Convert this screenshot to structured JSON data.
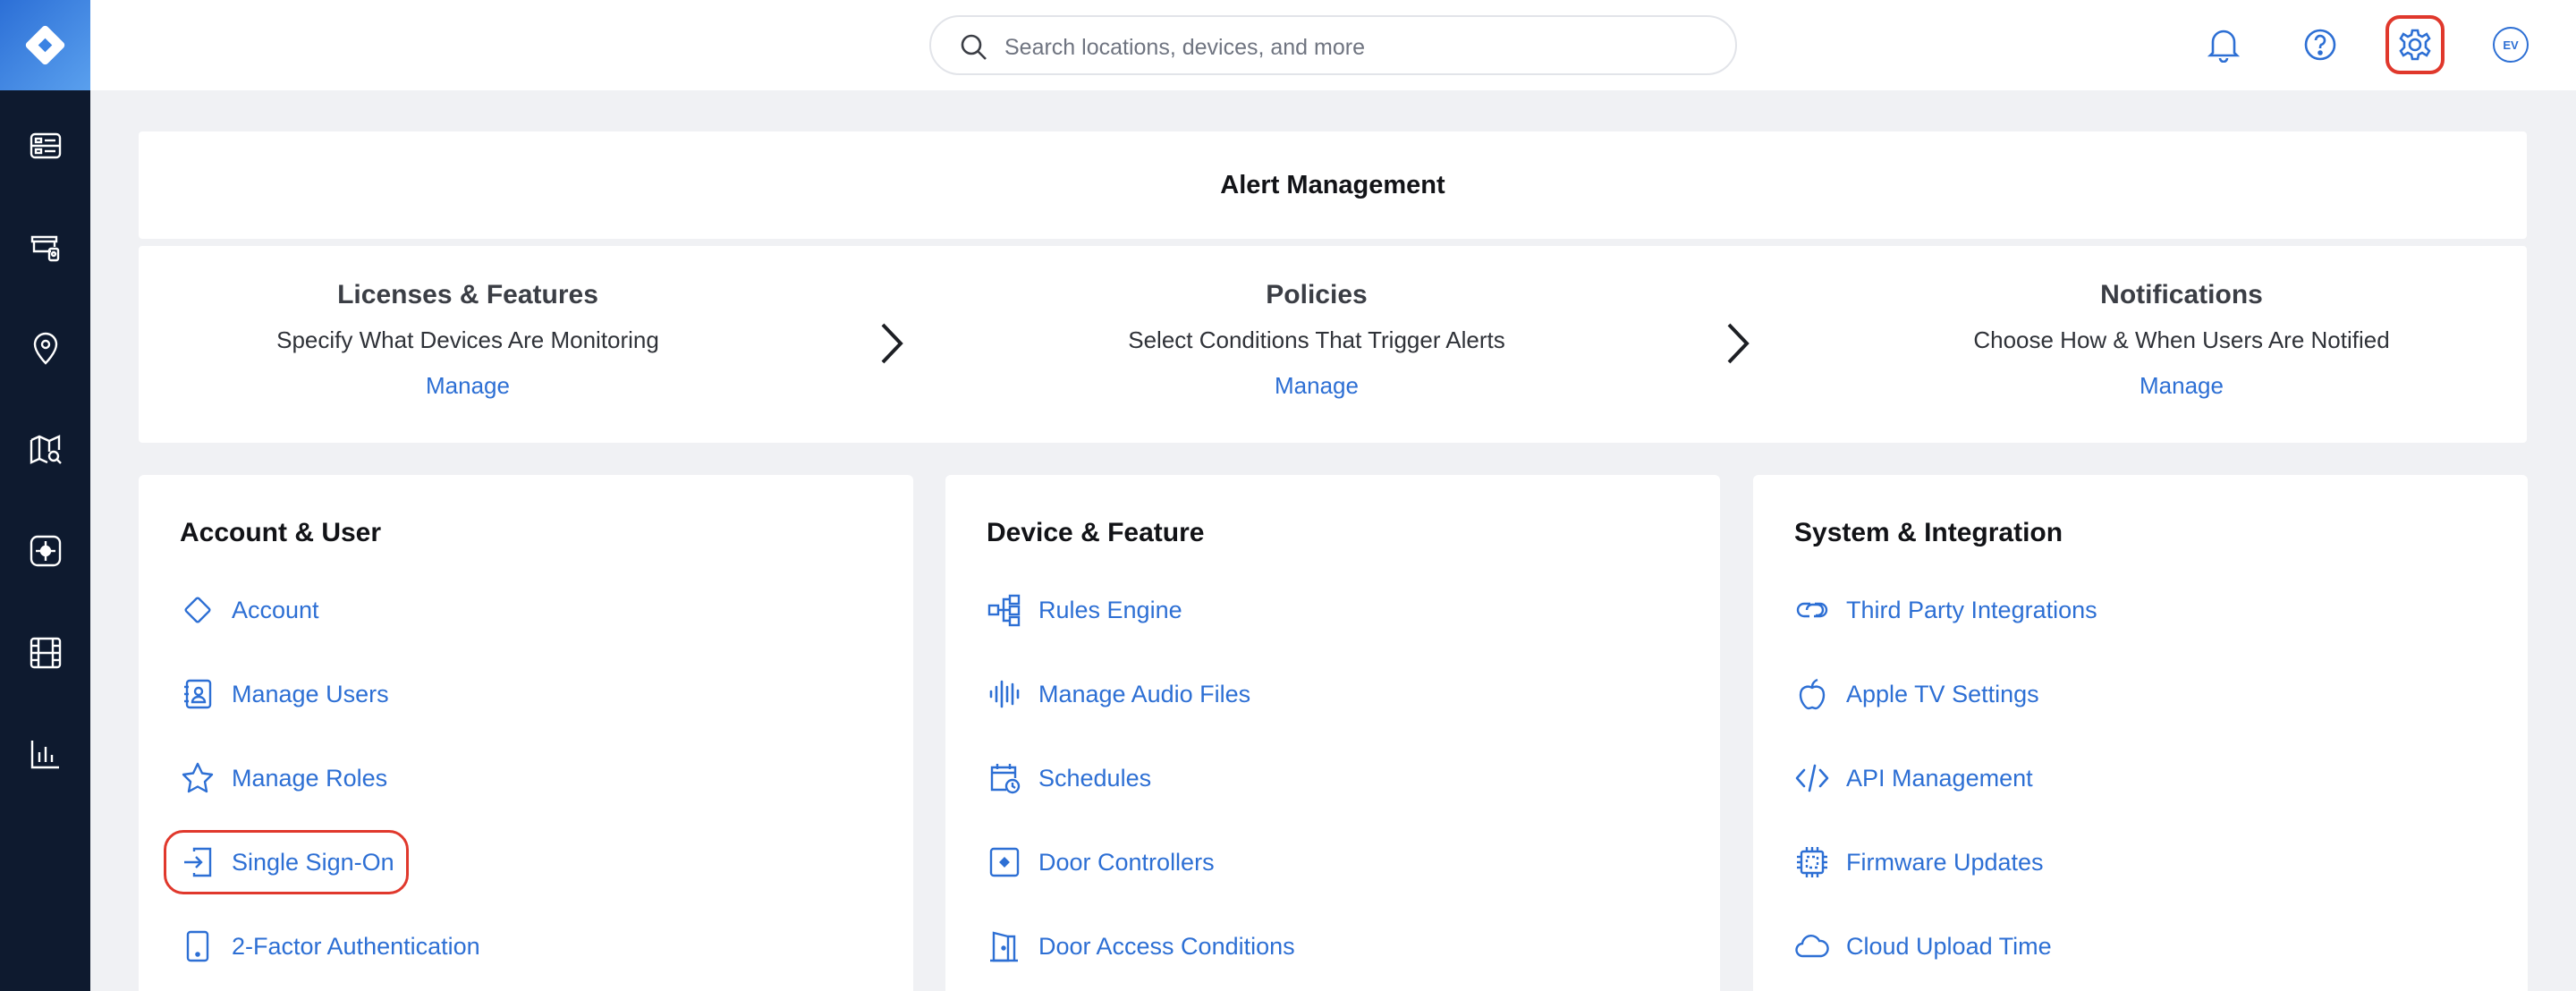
{
  "sidebar": {
    "logo": "brand-diamond-logo",
    "items": [
      {
        "icon": "dashboard-icon"
      },
      {
        "icon": "camera-devices-icon"
      },
      {
        "icon": "location-pin-icon"
      },
      {
        "icon": "map-search-icon"
      },
      {
        "icon": "access-control-icon"
      },
      {
        "icon": "film-archive-icon"
      },
      {
        "icon": "analytics-chart-icon"
      }
    ]
  },
  "header": {
    "search_placeholder": "Search locations, devices, and more",
    "avatar_initials": "EV",
    "accent": "#2d6fd4",
    "highlight": "#e0382c"
  },
  "alert_management": {
    "title": "Alert Management",
    "steps": [
      {
        "title": "Licenses & Features",
        "desc": "Specify What Devices Are Monitoring",
        "link": "Manage"
      },
      {
        "title": "Policies",
        "desc": "Select Conditions That Trigger Alerts",
        "link": "Manage"
      },
      {
        "title": "Notifications",
        "desc": "Choose How & When Users Are Notified",
        "link": "Manage"
      }
    ]
  },
  "sections": [
    {
      "title": "Account & User",
      "items": [
        {
          "label": "Account",
          "icon": "diamond-icon"
        },
        {
          "label": "Manage Users",
          "icon": "user-book-icon"
        },
        {
          "label": "Manage Roles",
          "icon": "star-icon"
        },
        {
          "label": "Single Sign-On",
          "icon": "sign-in-icon"
        },
        {
          "label": "2-Factor Authentication",
          "icon": "tablet-icon"
        }
      ]
    },
    {
      "title": "Device & Feature",
      "items": [
        {
          "label": "Rules Engine",
          "icon": "flow-nodes-icon"
        },
        {
          "label": "Manage Audio Files",
          "icon": "audio-wave-icon"
        },
        {
          "label": "Schedules",
          "icon": "calendar-clock-icon"
        },
        {
          "label": "Door Controllers",
          "icon": "door-controller-icon"
        },
        {
          "label": "Door Access Conditions",
          "icon": "door-icon"
        }
      ]
    },
    {
      "title": "System & Integration",
      "items": [
        {
          "label": "Third Party Integrations",
          "icon": "link-icon"
        },
        {
          "label": "Apple TV Settings",
          "icon": "apple-icon"
        },
        {
          "label": "API Management",
          "icon": "code-icon"
        },
        {
          "label": "Firmware Updates",
          "icon": "chip-icon"
        },
        {
          "label": "Cloud Upload Time",
          "icon": "cloud-icon"
        }
      ]
    }
  ]
}
